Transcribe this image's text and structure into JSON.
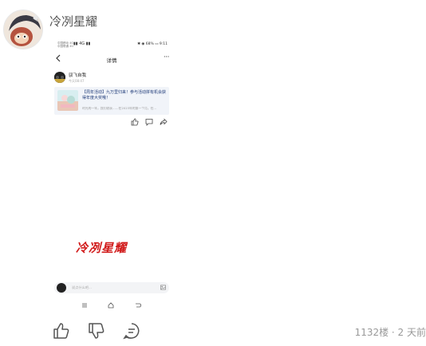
{
  "reply": {
    "username": "冷冽星耀",
    "floor_info": "1132楼 · 2 天前"
  },
  "phone": {
    "status_left_line1": "中国移动 4G",
    "status_left_line2": "中国联通 4G",
    "status_signal": "▮▮ 4G ▮▮",
    "status_right": "✱ ◉ 68% ▭ 9:11",
    "nav_title": "详情",
    "more_label": "···",
    "post": {
      "author": "驭飞自我",
      "time": "今天08:47"
    },
    "card": {
      "title": "【周年活动】九万里归来！参与活动拼有机会获得年度大奖哦！",
      "desc": "时光的一年，我们收获……在2023年的第一个月，在..."
    },
    "watermark": "冷冽星耀",
    "comment_placeholder": "说点什么吧..."
  },
  "icons": [
    "back-icon",
    "more-icon",
    "like-icon",
    "comment-icon",
    "share-icon",
    "image-icon",
    "menu-icon",
    "home-icon",
    "return-icon",
    "thumb-up-icon",
    "thumb-down-icon",
    "reply-icon"
  ],
  "colors": {
    "watermark": "#d11a1a",
    "card_title": "#1e3a78",
    "card_bg": "#f1f4f9"
  }
}
